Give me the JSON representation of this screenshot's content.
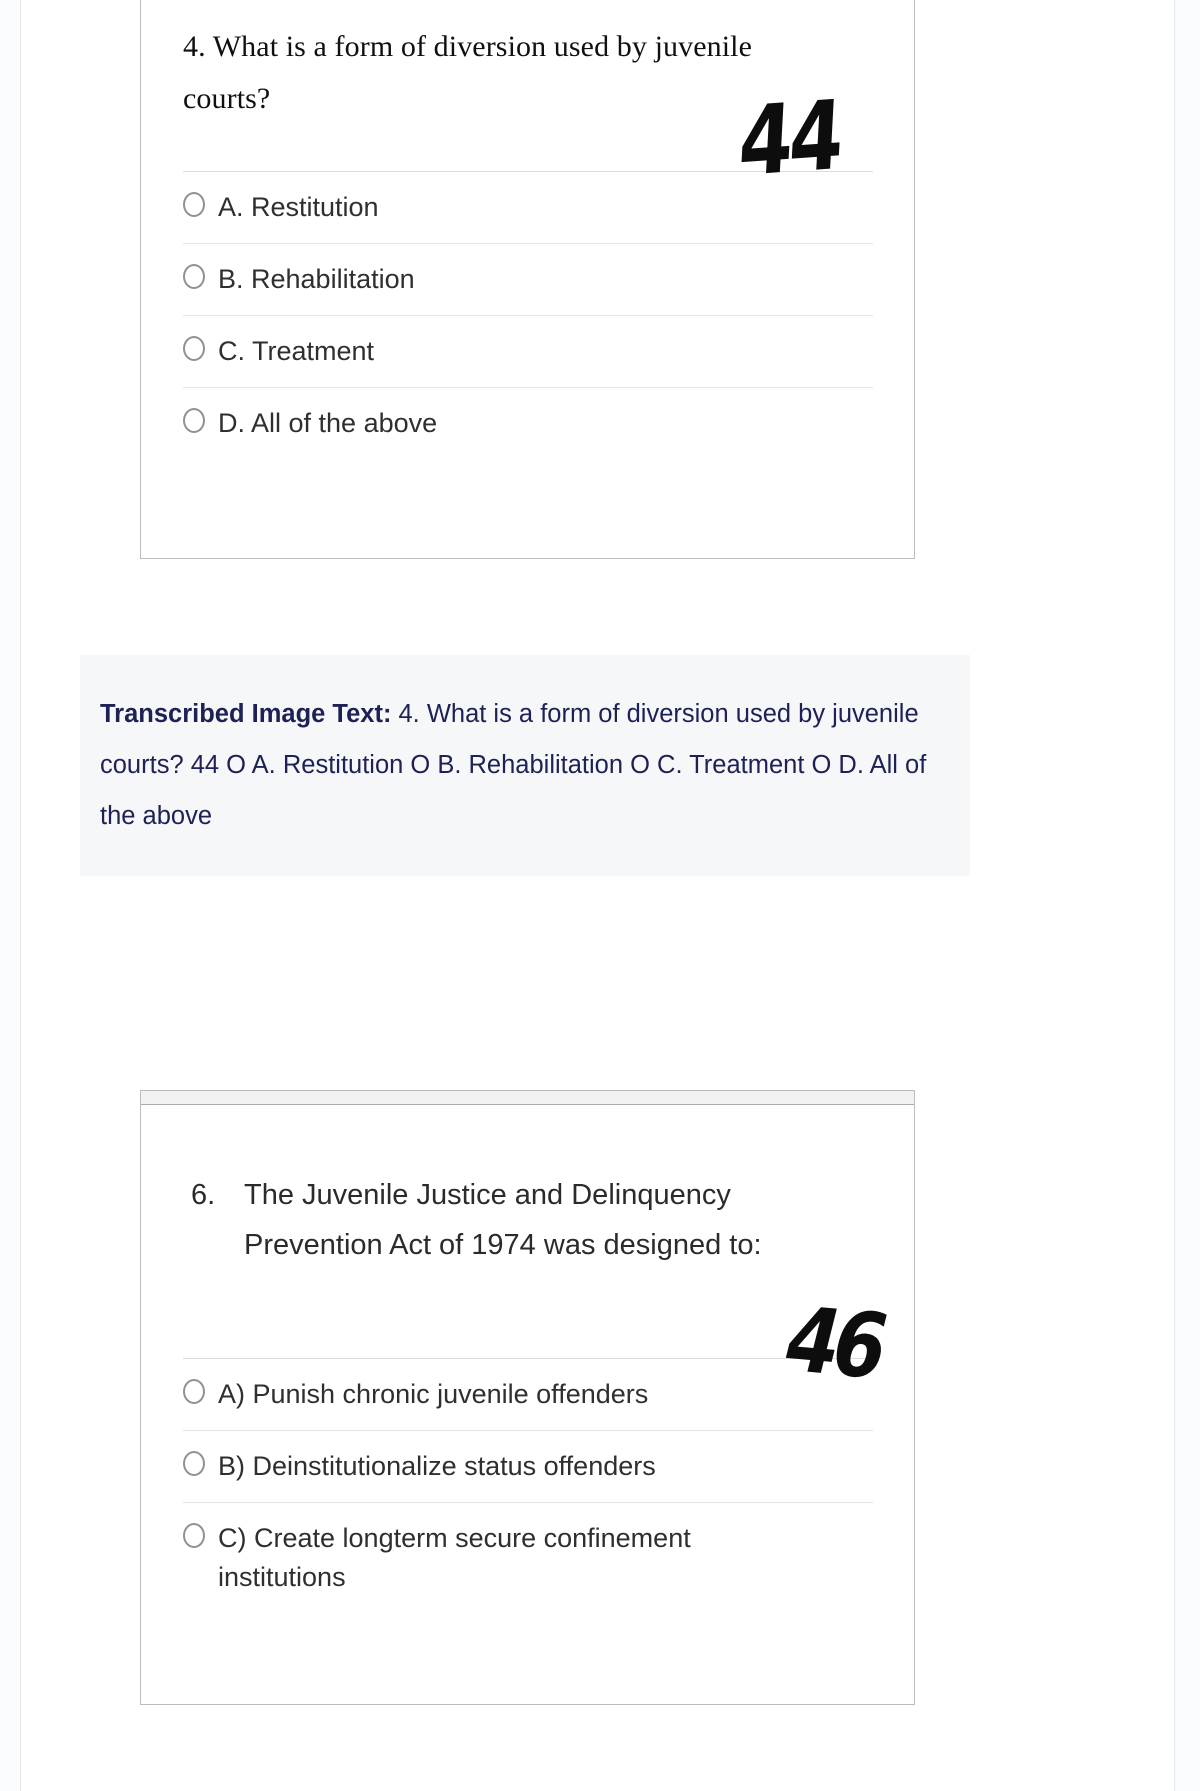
{
  "page": {
    "background_color": "#fbfcfd",
    "card_border_color": "#b9bcc0"
  },
  "question_4": {
    "number": "4.",
    "text": "4. What is a form of diversion used by juvenile courts?",
    "handwritten_mark": "44",
    "options": [
      {
        "id": "A",
        "label": "A. Restitution",
        "selected": false
      },
      {
        "id": "B",
        "label": "B. Rehabilitation",
        "selected": false
      },
      {
        "id": "C",
        "label": "C. Treatment",
        "selected": false
      },
      {
        "id": "D",
        "label": "D. All of the above",
        "selected": false
      }
    ]
  },
  "transcription": {
    "label": "Transcribed Image Text:",
    "body": "4. What is a form of diversion used by juvenile courts? 44 O A. Restitution O B. Rehabilitation O C. Treatment O D. All of the above",
    "text_color": "#1d2155",
    "background_color": "#f6f7f9"
  },
  "question_6": {
    "number": "6.",
    "text": "The Juvenile Justice and Delinquency Prevention Act of 1974 was designed to:",
    "handwritten_mark": "46",
    "options": [
      {
        "id": "A",
        "label": "A) Punish chronic juvenile offenders",
        "selected": false
      },
      {
        "id": "B",
        "label": "B) Deinstitutionalize status offenders",
        "selected": false
      },
      {
        "id": "C",
        "label": "C) Create longterm secure confinement institutions",
        "selected": false
      }
    ]
  }
}
